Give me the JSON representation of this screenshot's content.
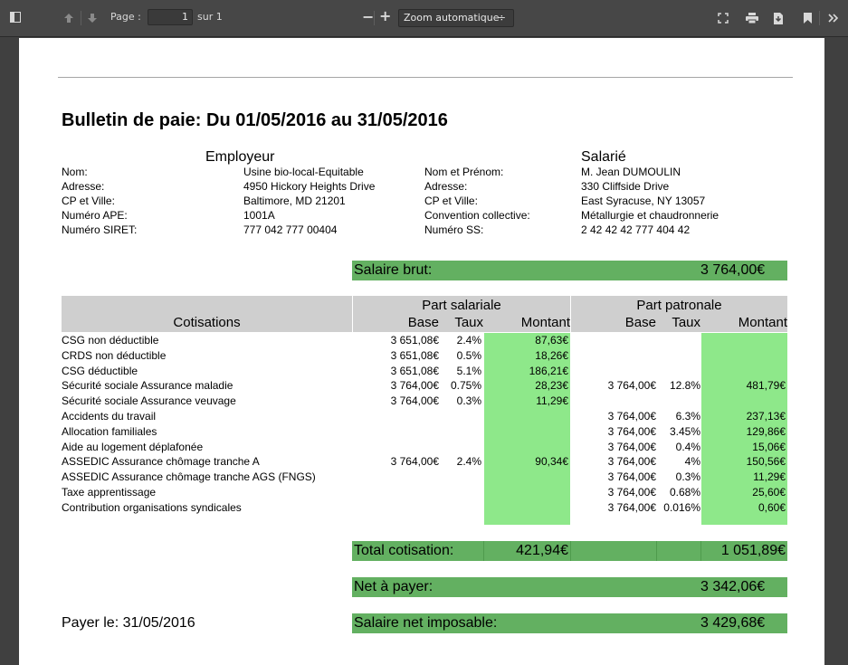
{
  "toolbar": {
    "page_label": "Page :",
    "page_value": "1",
    "page_total": "sur 1",
    "zoom_out": "−",
    "zoom_in": "+",
    "zoom_value": "Zoom automatique",
    "zoom_arrow": "÷"
  },
  "doc": {
    "title": "Bulletin de paie: Du 01/05/2016 au 31/05/2016",
    "employer_heading": "Employeur",
    "employee_heading": "Salarié",
    "employer_labels": [
      "Nom:",
      "Adresse:",
      "CP et Ville:",
      "Numéro APE:",
      "Numéro SIRET:"
    ],
    "employer_values": [
      "Usine bio-local-Equitable",
      "4950 Hickory Heights Drive",
      "Baltimore, MD 21201",
      "1001A",
      "777 042 777 00404"
    ],
    "employee_labels": [
      "Nom et Prénom:",
      "Adresse:",
      "CP et Ville:",
      "Convention collective:",
      "Numéro SS:"
    ],
    "employee_values": [
      "M. Jean DUMOULIN",
      "330 Cliffside Drive",
      "East Syracuse, NY 13057",
      "Métallurgie et chaudronnerie",
      "2 42 42 42 777 404 42"
    ],
    "salaire_brut_label": "Salaire brut:",
    "salaire_brut_value": "3 764,00€",
    "part_salariale": "Part salariale",
    "part_patronale": "Part patronale",
    "cotisations_header": "Cotisations",
    "col_base": "Base",
    "col_taux": "Taux",
    "col_montant": "Montant",
    "rows": [
      {
        "name": "CSG non déductible",
        "s_base": "3 651,08€",
        "s_taux": "2.4%",
        "s_montant": "87,63€",
        "p_base": "",
        "p_taux": "",
        "p_montant": ""
      },
      {
        "name": "CRDS non déductible",
        "s_base": "3 651,08€",
        "s_taux": "0.5%",
        "s_montant": "18,26€",
        "p_base": "",
        "p_taux": "",
        "p_montant": ""
      },
      {
        "name": "CSG déductible",
        "s_base": "3 651,08€",
        "s_taux": "5.1%",
        "s_montant": "186,21€",
        "p_base": "",
        "p_taux": "",
        "p_montant": ""
      },
      {
        "name": "Sécurité sociale Assurance maladie",
        "s_base": "3 764,00€",
        "s_taux": "0.75%",
        "s_montant": "28,23€",
        "p_base": "3 764,00€",
        "p_taux": "12.8%",
        "p_montant": "481,79€"
      },
      {
        "name": "Sécurité sociale Assurance veuvage",
        "s_base": "3 764,00€",
        "s_taux": "0.3%",
        "s_montant": "11,29€",
        "p_base": "",
        "p_taux": "",
        "p_montant": ""
      },
      {
        "name": "Accidents du travail",
        "s_base": "",
        "s_taux": "",
        "s_montant": "",
        "p_base": "3 764,00€",
        "p_taux": "6.3%",
        "p_montant": "237,13€"
      },
      {
        "name": "Allocation familiales",
        "s_base": "",
        "s_taux": "",
        "s_montant": "",
        "p_base": "3 764,00€",
        "p_taux": "3.45%",
        "p_montant": "129,86€"
      },
      {
        "name": "Aide au logement déplafonée",
        "s_base": "",
        "s_taux": "",
        "s_montant": "",
        "p_base": "3 764,00€",
        "p_taux": "0.4%",
        "p_montant": "15,06€"
      },
      {
        "name": "ASSEDIC Assurance chômage tranche A",
        "s_base": "3 764,00€",
        "s_taux": "2.4%",
        "s_montant": "90,34€",
        "p_base": "3 764,00€",
        "p_taux": "4%",
        "p_montant": "150,56€"
      },
      {
        "name": "ASSEDIC Assurance chômage tranche AGS (FNGS)",
        "s_base": "",
        "s_taux": "",
        "s_montant": "",
        "p_base": "3 764,00€",
        "p_taux": "0.3%",
        "p_montant": "11,29€"
      },
      {
        "name": "Taxe apprentissage",
        "s_base": "",
        "s_taux": "",
        "s_montant": "",
        "p_base": "3 764,00€",
        "p_taux": "0.68%",
        "p_montant": "25,60€"
      },
      {
        "name": "Contribution organisations syndicales",
        "s_base": "",
        "s_taux": "",
        "s_montant": "",
        "p_base": "3 764,00€",
        "p_taux": "0.016%",
        "p_montant": "0,60€"
      }
    ],
    "total_label": "Total cotisation:",
    "total_salarial": "421,94€",
    "total_patronal": "1 051,89€",
    "net_label": "Net à payer:",
    "net_value": "3 342,06€",
    "imposable_label": "Salaire net imposable:",
    "imposable_value": "3 429,68€",
    "payer_le": "Payer le: 31/05/2016"
  },
  "colors": {
    "green": "#63b061",
    "light_green": "#8ee88a",
    "grey": "#cfcfcf"
  }
}
